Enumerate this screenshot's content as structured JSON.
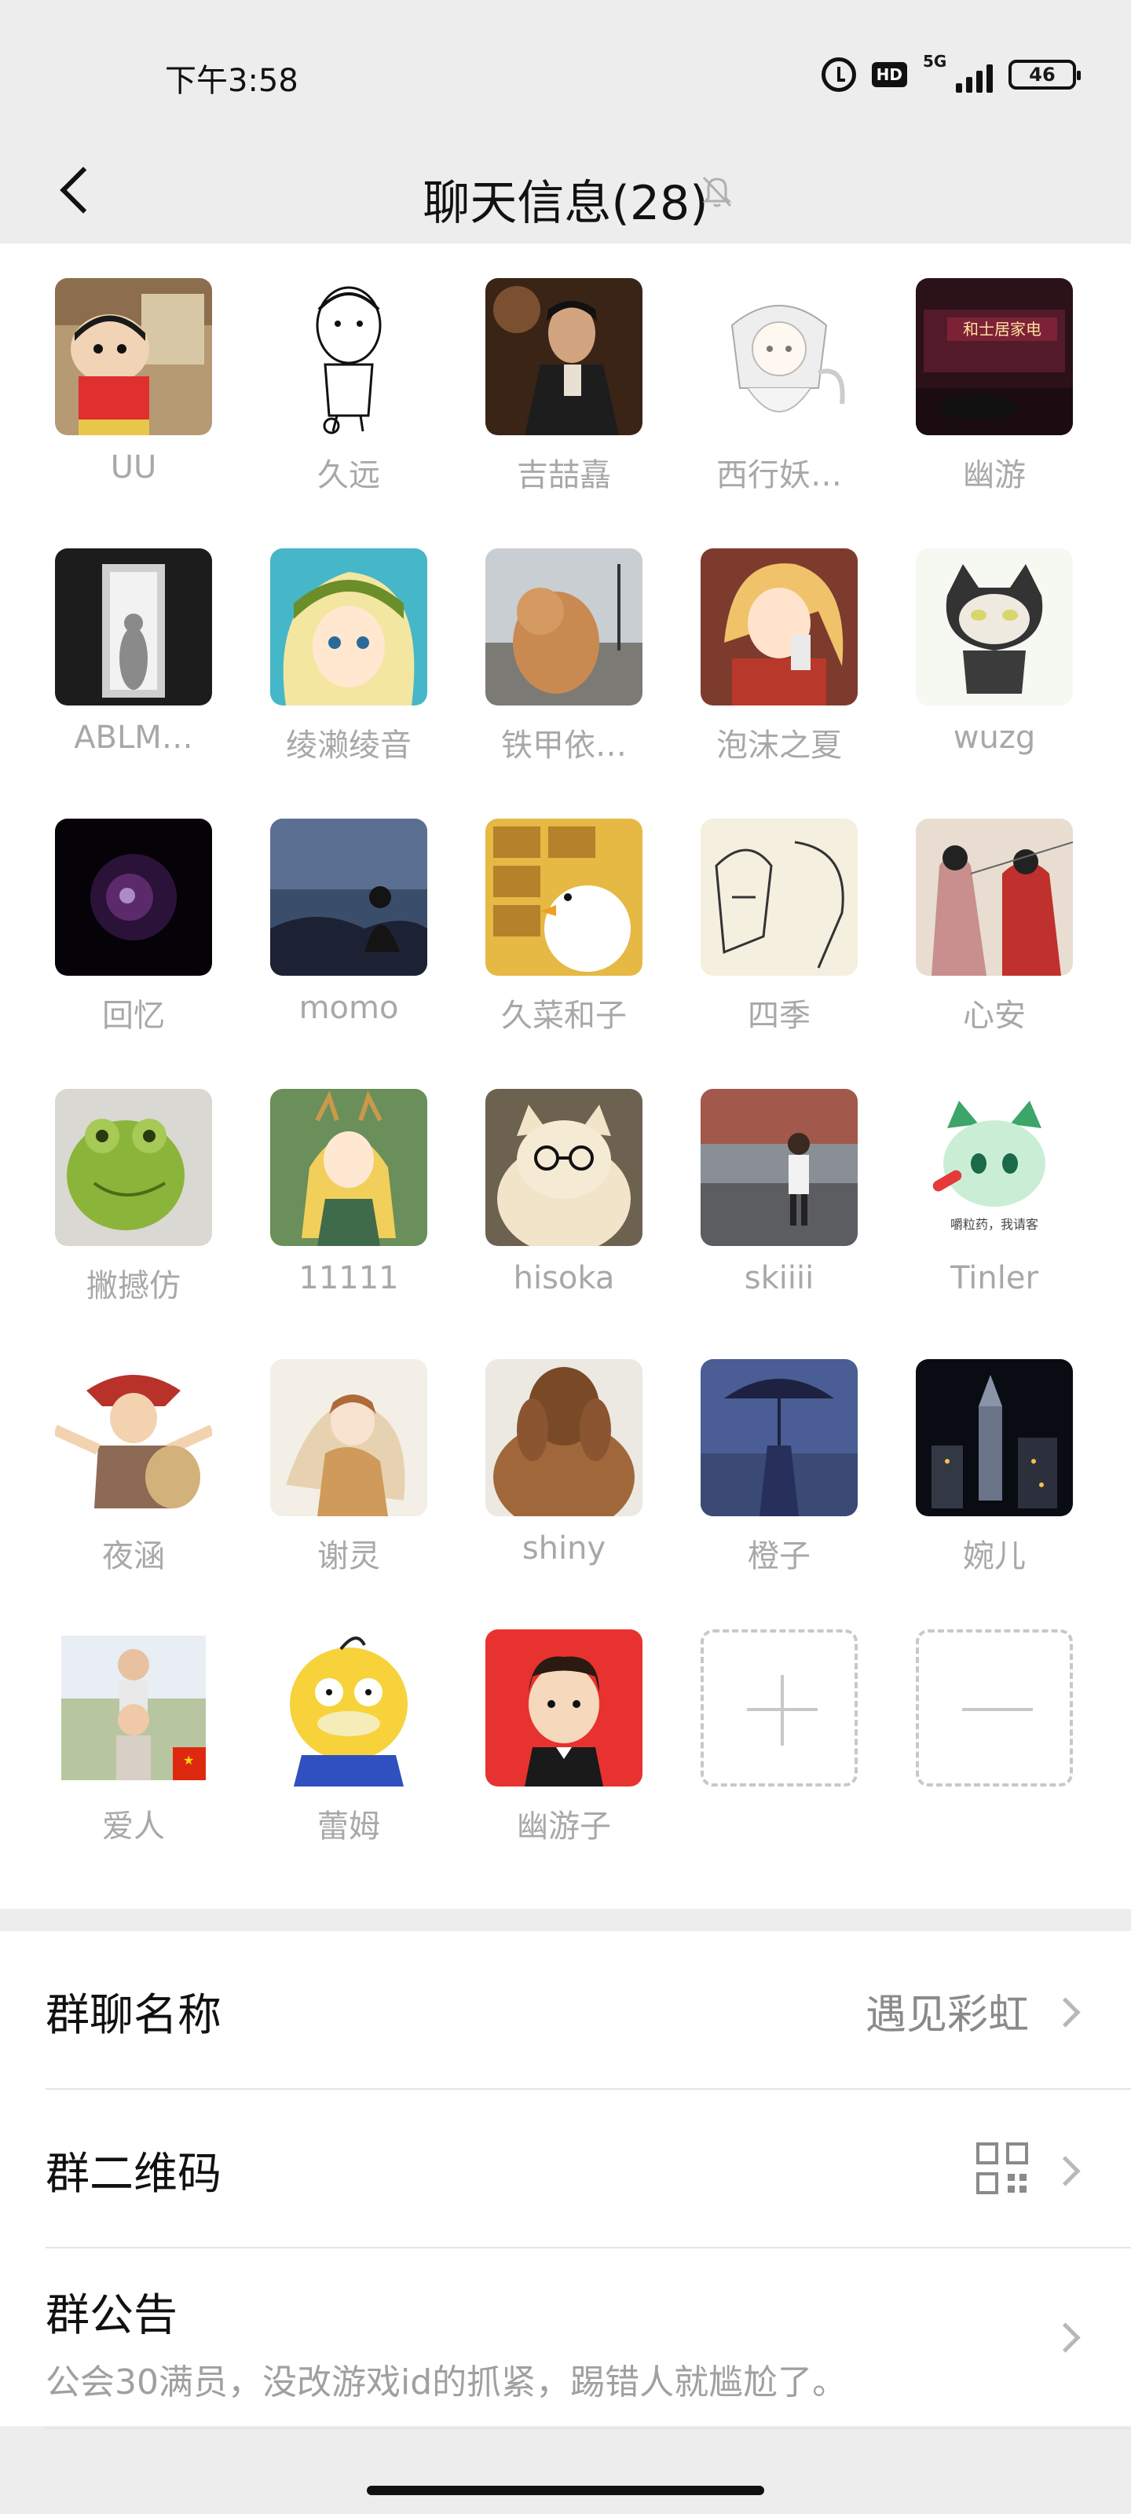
{
  "status_bar": {
    "time": "下午3:58",
    "hd": "HD",
    "network": "5G",
    "battery": "46"
  },
  "header": {
    "title": "聊天信息(28)"
  },
  "members": [
    {
      "name": "UU"
    },
    {
      "name": "久远"
    },
    {
      "name": "吉喆嚞"
    },
    {
      "name": "西行妖…"
    },
    {
      "name": "幽游"
    },
    {
      "name": "ABLM…"
    },
    {
      "name": "绫濑绫音"
    },
    {
      "name": "铁甲依…"
    },
    {
      "name": "泡沫之夏"
    },
    {
      "name": "wuzg"
    },
    {
      "name": "回忆"
    },
    {
      "name": "momo"
    },
    {
      "name": "久菜和子"
    },
    {
      "name": "四季"
    },
    {
      "name": "心安"
    },
    {
      "name": "撇撼仿"
    },
    {
      "name": "11111"
    },
    {
      "name": "hisoka"
    },
    {
      "name": "skiiii"
    },
    {
      "name": "Tinler"
    },
    {
      "name": "夜涵"
    },
    {
      "name": "谢灵"
    },
    {
      "name": "shiny"
    },
    {
      "name": "橙子"
    },
    {
      "name": "婉儿"
    },
    {
      "name": "爱人"
    },
    {
      "name": "蕾姆"
    },
    {
      "name": "幽游子"
    }
  ],
  "avatar_text": {
    "shop_sign": "和士居家电",
    "tinler_caption": "嚼粒药，我请客"
  },
  "settings": {
    "group_name_label": "群聊名称",
    "group_name_value": "遇见彩虹",
    "qr_label": "群二维码",
    "notice_label": "群公告",
    "notice_text": "公会30满员，没改游戏id的抓紧，踢错人就尴尬了。"
  },
  "colors": {
    "page_bg": "#ededed",
    "panel_bg": "#ffffff",
    "muted_text": "#a8a8a8"
  }
}
